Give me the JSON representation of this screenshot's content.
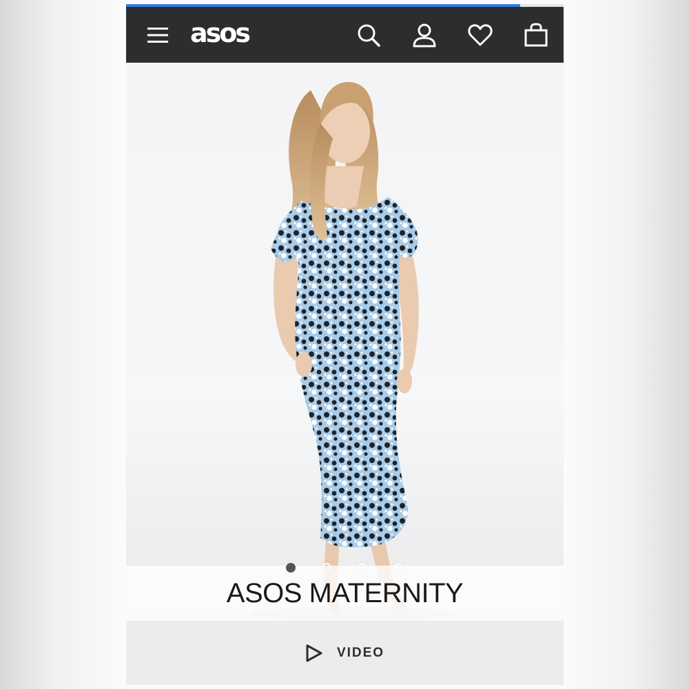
{
  "header": {
    "logo_text": "asos",
    "icons": [
      "menu-icon",
      "search-icon",
      "account-icon",
      "heart-icon",
      "bag-icon"
    ],
    "background_color": "#2d2d2d"
  },
  "load_progress": 0.9,
  "product_image": {
    "carousel": {
      "total": 4,
      "active_index": 0
    }
  },
  "brand": {
    "name": "ASOS MATERNITY"
  },
  "video": {
    "label": "VIDEO",
    "icon": "play-icon"
  },
  "colors": {
    "accent": "#2b7de1",
    "text_dark": "#1a1a1a",
    "dress_blue": "#a8cbe8"
  }
}
